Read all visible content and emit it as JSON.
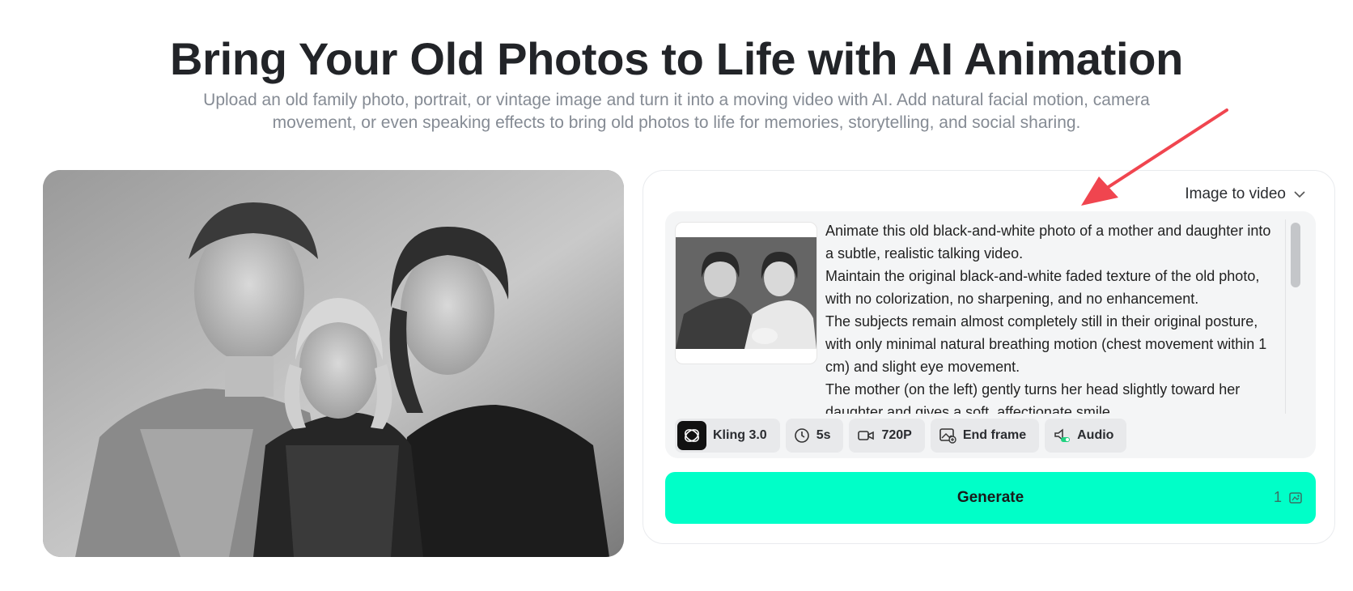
{
  "hero": {
    "title": "Bring Your Old Photos to Life with AI Animation",
    "subtitle": "Upload an old family photo, portrait, or vintage image and turn it into a moving video with AI. Add natural facial motion, camera movement, or even speaking effects to bring old photos to life for memories, storytelling, and social sharing."
  },
  "panel": {
    "mode": "Image to video",
    "prompt_lines": [
      "Animate this old black-and-white photo of a mother and daughter into a subtle, realistic talking video.",
      "Maintain the original black-and-white faded texture of the old photo, with no colorization, no sharpening, and no enhancement.",
      "The subjects remain almost completely still in their original posture, with only minimal natural breathing motion (chest movement within 1 cm) and slight eye movement.",
      "The mother (on the left) gently turns her head slightly toward her daughter and gives a soft, affectionate smile."
    ],
    "options": {
      "model": "Kling 3.0",
      "duration": "5s",
      "resolution": "720P",
      "end_frame": "End frame",
      "audio": "Audio"
    },
    "generate_label": "Generate",
    "credit_cost": "1"
  },
  "colors": {
    "accent": "#00ffc8",
    "annotation_arrow": "#f0454f"
  },
  "icons": [
    "kling-logo-icon",
    "clock-icon",
    "video-camera-icon",
    "end-frame-icon",
    "audio-toggle-icon",
    "chevron-down-icon",
    "credit-icon"
  ]
}
